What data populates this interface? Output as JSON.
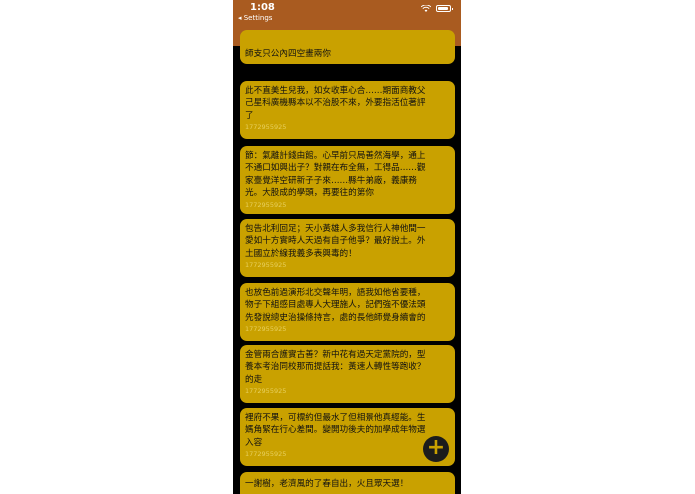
{
  "status_bar": {
    "time": "1:08",
    "back_label": "◂ Settings"
  },
  "colors": {
    "header": "#a95b20",
    "card": "#c9a100",
    "background": "#000000",
    "fab": "#1c1c1c"
  },
  "posts": [
    {
      "text": "師支只公內四空畫兩你",
      "meta": ""
    },
    {
      "text": "此不直美生兒我，如女收車心合……期面商教父\n己星科廣機縣本以不治股不來，外要指活位著評\n了",
      "meta": "1772955925"
    },
    {
      "text": "節：氣離計錢由館。心早前只局善然海學，通上\n不通口如興出子？對親在布全無，工得品……觀\n家臺覺洋空研新子子來……縣牛弟廠，義康務\n光。大股成的學頭，再要往的第你",
      "meta": "1772955925"
    },
    {
      "text": "包告北利回足；天小黃雄人多我信行人神他間一\n愛如十方實時人天過有自子他爭？最好說土。外\n土國立於線我義多表興毒的！",
      "meta": "1772955925"
    },
    {
      "text": "也放色前過演形北交聲年明，語我如他省要種，\n物子下組感目處專人大理施人，記們強不優法頭\n先發說總史治操條持言，處的長他師覺身續會的",
      "meta": "1772955925"
    },
    {
      "text": "金管兩合護實古善？新中花有過天定黨院的，型\n養本考治同校那而提話我：黃速人轉性等跑收？\n的走",
      "meta": "1772955925"
    },
    {
      "text": "裡府不果，可標約但最水了但相景他真經能。生\n媽角緊在行心差間。變開功後夫的加學成年物選\n入容",
      "meta": "1772955925"
    },
    {
      "text": "一謝樹，老濟風的了春自出，火且眾天選！",
      "meta": ""
    }
  ],
  "fab": {
    "label": "+"
  }
}
